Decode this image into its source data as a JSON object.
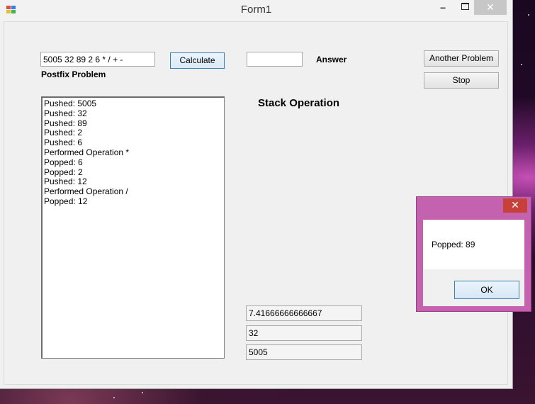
{
  "window": {
    "title": "Form1",
    "minimize": "–",
    "close": "✕"
  },
  "postfix": {
    "input_value": "5005 32 89 2 6 * / + -",
    "label": "Postfix Problem"
  },
  "calculate_label": "Calculate",
  "answer": {
    "value": "",
    "label": "Answer"
  },
  "another_problem_label": "Another Problem",
  "stop_label": "Stop",
  "stack_operation_label": "Stack Operation",
  "log_lines": [
    "Pushed: 5005",
    "Pushed: 32",
    "Pushed: 89",
    "Pushed: 2",
    "Pushed: 6",
    "Performed Operation *",
    "Popped: 6",
    "Popped: 2",
    "Pushed: 12",
    "Performed Operation /",
    "Popped: 12"
  ],
  "stack_values": [
    "7.41666666666667",
    "32",
    "5005"
  ],
  "message_box": {
    "text": "Popped: 89",
    "ok_label": "OK",
    "close": "✕"
  }
}
